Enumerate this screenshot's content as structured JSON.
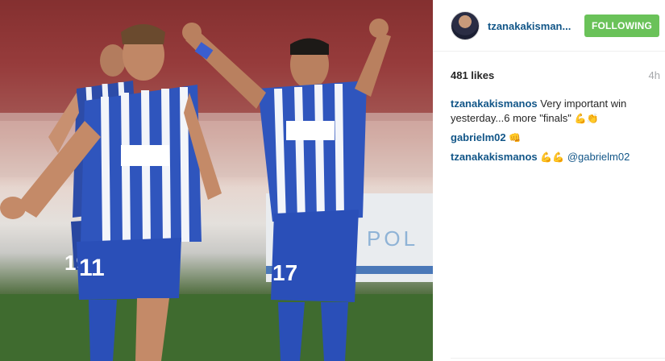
{
  "post": {
    "username": "tzanakakisman...",
    "follow_label": "FOLLOWING",
    "likes": "481 likes",
    "time": "4h"
  },
  "comments": [
    {
      "user": "tzanakakismanos",
      "text": "Very important win yesterday...6 more \"finals\" ",
      "emoji": "💪👏"
    },
    {
      "user": "gabrielm02",
      "text": " ",
      "emoji": "👊"
    },
    {
      "user": "tzanakakismanos",
      "text": " ",
      "emoji": "💪💪",
      "mention": "@gabrielm02"
    }
  ],
  "photo": {
    "jersey_numbers": [
      "19",
      "11",
      "17"
    ]
  },
  "colors": {
    "link": "#125688",
    "follow_green": "#6ac259",
    "jersey_blue": "#2c4fb3"
  }
}
